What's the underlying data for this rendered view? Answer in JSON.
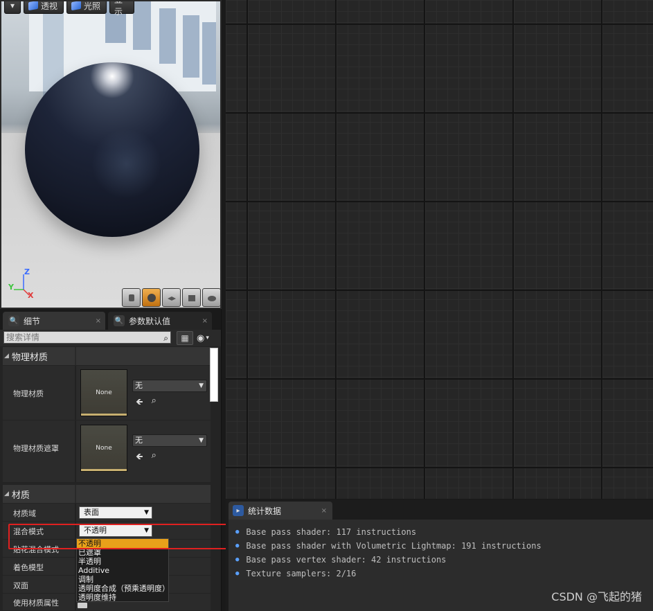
{
  "viewport": {
    "buttons": {
      "perspective": "透视",
      "lighting": "光照",
      "show": "显示"
    },
    "axes": {
      "z": "Z",
      "y": "Y",
      "x": "X"
    },
    "preview_shapes": [
      "cylinder",
      "sphere",
      "plane",
      "cube",
      "custom"
    ],
    "active_shape": "sphere"
  },
  "details": {
    "tabs": [
      {
        "label": "细节",
        "close": "×"
      },
      {
        "label": "参数默认值",
        "close": "×"
      }
    ],
    "search_placeholder": "搜索详情",
    "categories": {
      "physical_material": {
        "title": "物理材质",
        "rows": [
          {
            "label": "物理材质",
            "thumb": "None",
            "value": "无"
          },
          {
            "label": "物理材质遮罩",
            "thumb": "None",
            "value": "无"
          }
        ]
      },
      "material": {
        "title": "材质",
        "rows": [
          {
            "label": "材质域",
            "value": "表面"
          },
          {
            "label": "混合模式",
            "value": "不透明"
          },
          {
            "label": "贴花混合模式",
            "value": ""
          },
          {
            "label": "着色模型",
            "value": ""
          },
          {
            "label": "双面",
            "value": ""
          },
          {
            "label": "使用材质属性",
            "value": ""
          }
        ]
      }
    },
    "blend_dropdown": {
      "options": [
        "不透明",
        "已遮罩",
        "半透明",
        "Additive",
        "调制",
        "透明度合成（预乘透明度）",
        "透明度维持"
      ],
      "selected": "不透明"
    }
  },
  "stats": {
    "tab_label": "统计数据",
    "lines": [
      "Base pass shader: 117 instructions",
      "Base pass shader with Volumetric Lightmap: 191 instructions",
      "Base pass vertex shader: 42 instructions",
      "Texture samplers: 2/16"
    ],
    "watermark": "CSDN @飞起的猪"
  },
  "colors": {
    "selection": "#e8a11a",
    "highlight_box": "#e02020",
    "accent_blue": "#5aa0ff"
  }
}
